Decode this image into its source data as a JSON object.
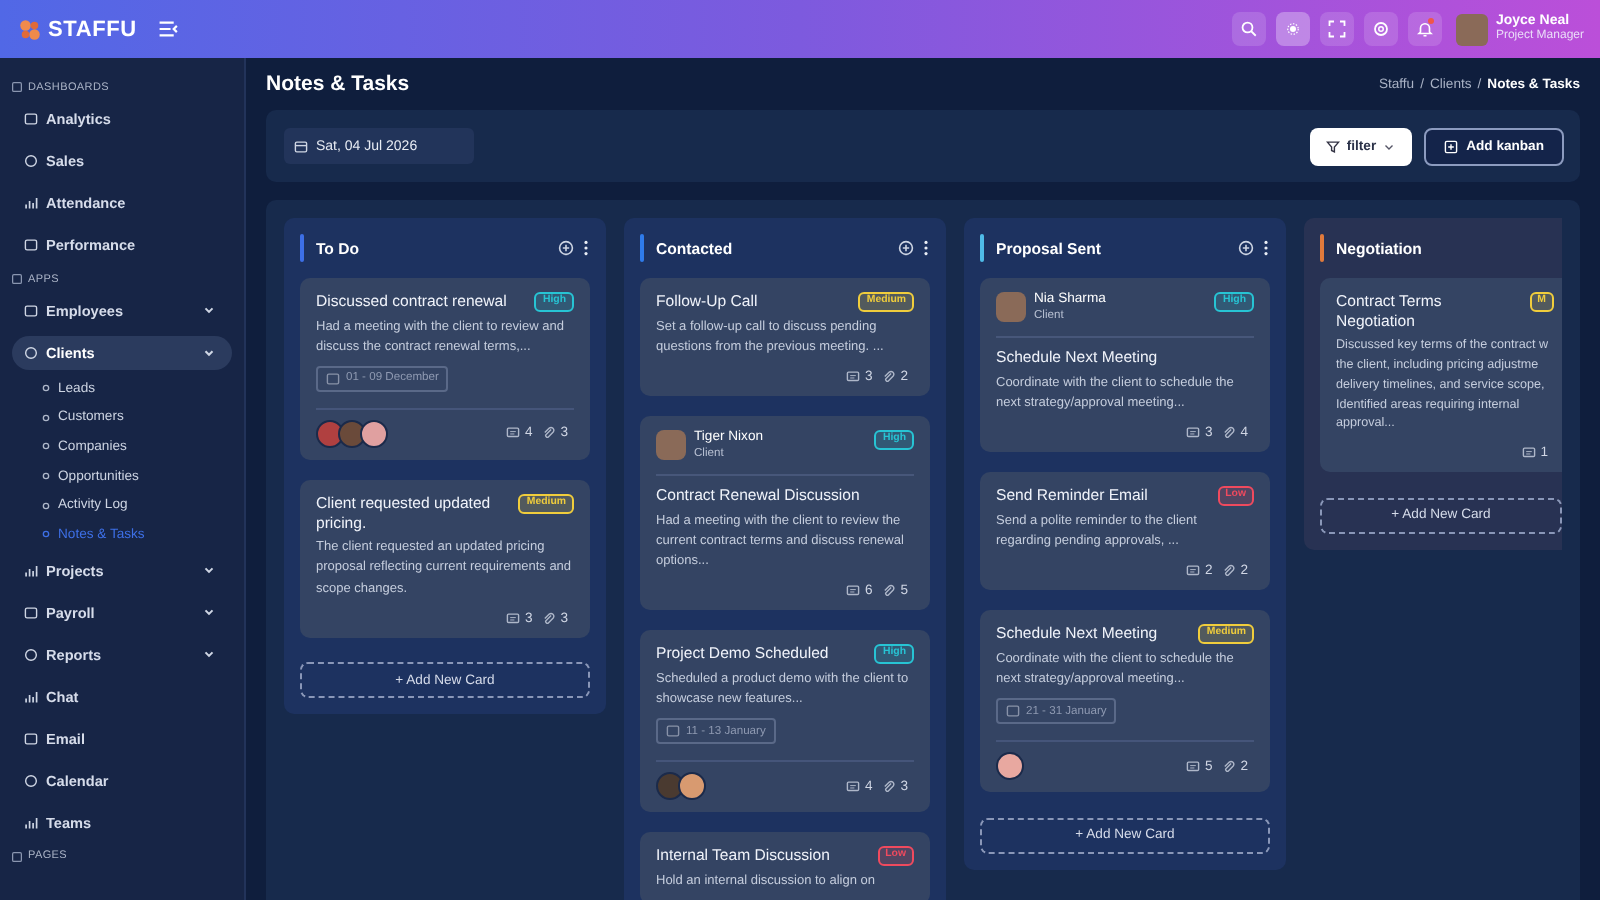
{
  "header": {
    "logo": "STAFFU",
    "user": {
      "name": "Joyce Neal",
      "role": "Project Manager"
    },
    "notifications": true
  },
  "sidebar": {
    "sections": [
      {
        "label": "DASHBOARDS",
        "items": [
          {
            "label": "Analytics",
            "selected": false
          },
          {
            "label": "Sales",
            "selected": false
          },
          {
            "label": "Attendance",
            "selected": false
          },
          {
            "label": "Performance",
            "selected": false
          }
        ]
      },
      {
        "label": "APPS",
        "items": [
          {
            "label": "Employees",
            "selected": false,
            "expanded": false
          },
          {
            "label": "Clients",
            "selected": true,
            "expanded": true,
            "children": [
              {
                "label": "Leads",
                "selected": false
              },
              {
                "label": "Customers",
                "selected": false
              },
              {
                "label": "Companies",
                "selected": false
              },
              {
                "label": "Opportunities",
                "selected": false
              },
              {
                "label": "Activity Log",
                "selected": false
              },
              {
                "label": "Notes & Tasks",
                "selected": true
              }
            ]
          },
          {
            "label": "Projects",
            "selected": false,
            "expanded": false
          },
          {
            "label": "Payroll",
            "selected": false,
            "expanded": false
          },
          {
            "label": "Reports",
            "selected": false,
            "expanded": false
          },
          {
            "label": "Chat",
            "selected": false
          },
          {
            "label": "Email",
            "selected": false
          },
          {
            "label": "Calendar",
            "selected": false
          },
          {
            "label": "Teams",
            "selected": false
          }
        ]
      },
      {
        "label": "PAGES"
      }
    ]
  },
  "page": {
    "title": "Notes & Tasks",
    "breadcrumb": [
      "Staffu",
      "Clients",
      "Notes & Tasks"
    ],
    "breadcrumb_separator": "/"
  },
  "toolbar": {
    "date": "Sat, 04 Jul 2026",
    "filter": "filter",
    "add": "Add kanban"
  },
  "columns": [
    {
      "title": "To Do",
      "color": "#3d6fe6",
      "has_actions": true,
      "add_card": "+ Add New Card",
      "cards": [
        {
          "title": "Discussed contract renewal",
          "priority": {
            "label": "High",
            "color": "#27c4d4"
          },
          "description": "Had a meeting with the client to review and discuss the contract renewal terms,...",
          "date": "01 - 09 December",
          "avatars": [
            {
              "color": "#b04040"
            },
            {
              "color": "#6a4a3a"
            },
            {
              "color": "#e0a0a0"
            }
          ],
          "comments": "4",
          "attachments": "3"
        },
        {
          "title": "Client requested updated pricing.",
          "priority": {
            "label": "Medium",
            "color": "#f0cd3c"
          },
          "description": "The client requested an updated pricing proposal reflecting current requirements and scope changes.",
          "comments": "3",
          "attachments": "3"
        }
      ]
    },
    {
      "title": "Contacted",
      "color": "#2f7bea",
      "has_actions": true,
      "cards": [
        {
          "title": "Follow-Up Call",
          "priority": {
            "label": "Medium",
            "color": "#f0cd3c"
          },
          "description": "Set a follow-up call to discuss pending questions from the previous meeting. ...",
          "comments": "3",
          "attachments": "2"
        },
        {
          "contact": {
            "name": "Tiger Nixon",
            "role": "Client"
          },
          "title": "Contract Renewal Discussion",
          "priority": {
            "label": "High",
            "color": "#27c4d4"
          },
          "description": "Had a meeting with the client to review the current contract terms and discuss renewal options...",
          "comments": "6",
          "attachments": "5"
        },
        {
          "title": "Project Demo Scheduled",
          "priority": {
            "label": "High",
            "color": "#27c4d4"
          },
          "description": "Scheduled a product demo with the client to showcase new features...",
          "date": "11 - 13 January",
          "avatars": [
            {
              "color": "#4a3a30"
            },
            {
              "color": "#d89a70"
            }
          ],
          "comments": "4",
          "attachments": "3"
        },
        {
          "title": "Internal Team Discussion",
          "priority": {
            "label": "Low",
            "color": "#f04a5e"
          },
          "description": "Hold an internal discussion to align on"
        }
      ]
    },
    {
      "title": "Proposal Sent",
      "color": "#4fbbe8",
      "has_actions": true,
      "add_card": "+ Add New Card",
      "cards": [
        {
          "contact": {
            "name": "Nia Sharma",
            "role": "Client"
          },
          "title": "Schedule Next Meeting",
          "priority": {
            "label": "High",
            "color": "#27c4d4"
          },
          "description": "Coordinate with the client to schedule the next strategy/approval meeting...",
          "comments": "3",
          "attachments": "4"
        },
        {
          "title": "Send Reminder Email",
          "priority": {
            "label": "Low",
            "color": "#f04a5e"
          },
          "description": "Send a polite reminder to the client regarding pending approvals, ...",
          "comments": "2",
          "attachments": "2"
        },
        {
          "title": "Schedule Next Meeting",
          "priority": {
            "label": "Medium",
            "color": "#f0cd3c"
          },
          "description": "Coordinate with the client to schedule the next strategy/approval meeting...",
          "date": "21 - 31 January",
          "avatars": [
            {
              "color": "#e8a8a0"
            }
          ],
          "comments": "5",
          "attachments": "2"
        }
      ]
    },
    {
      "title": "Negotiation",
      "color": "#e07a3c",
      "has_actions": false,
      "add_card": "+ Add New Card",
      "cards": [
        {
          "title": "Contract Terms Negotiation",
          "priority": {
            "label": "M",
            "color": "#f0cd3c"
          },
          "description_lines": [
            "Discussed key terms of the contract w",
            "the client, including pricing adjustme",
            "delivery timelines, and service scope,",
            "Identified areas requiring internal",
            "approval..."
          ],
          "comments": "1"
        }
      ]
    }
  ]
}
